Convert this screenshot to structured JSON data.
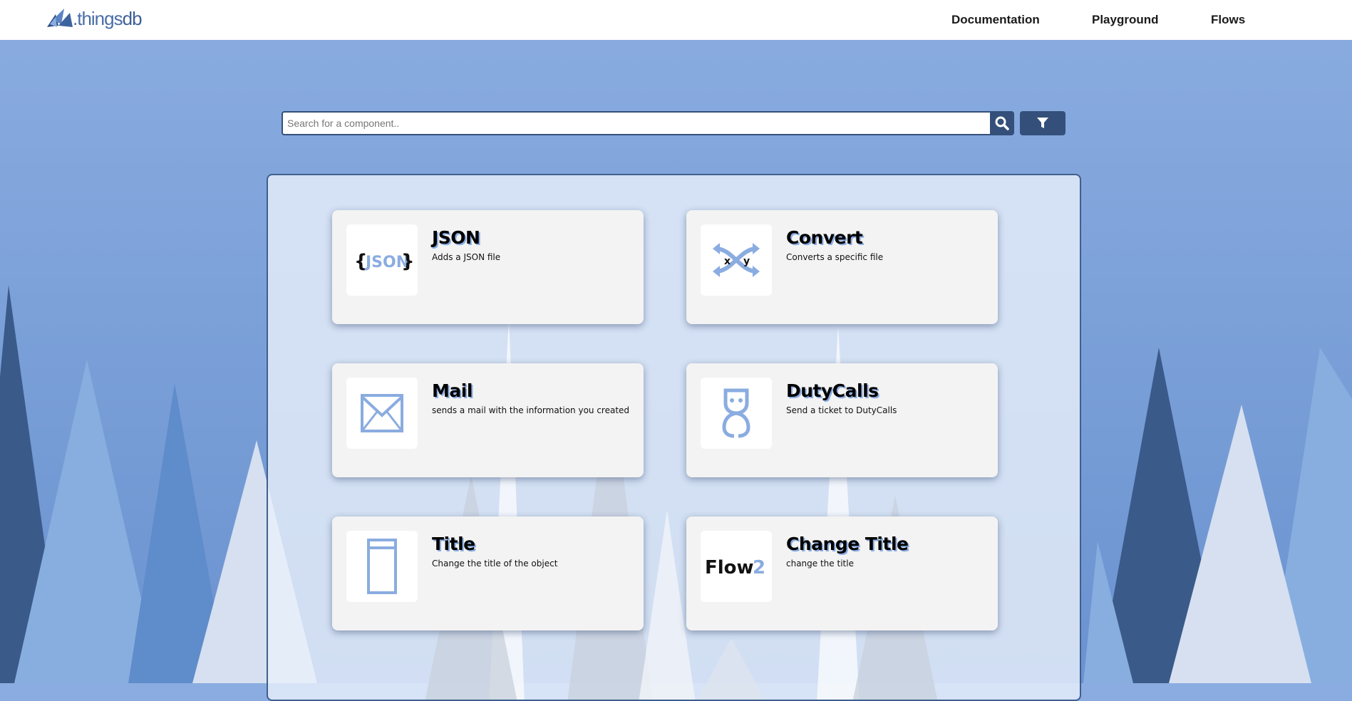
{
  "brand": {
    "name_prefix": ".things",
    "name_suffix": "db"
  },
  "nav": {
    "links": [
      {
        "label": "Documentation"
      },
      {
        "label": "Playground"
      },
      {
        "label": "Flows"
      }
    ]
  },
  "search": {
    "placeholder": "Search for a component..",
    "value": ""
  },
  "components": [
    {
      "title": "JSON",
      "description": "Adds a JSON file",
      "icon": "json-icon"
    },
    {
      "title": "Convert",
      "description": "Converts a specific file",
      "icon": "convert-xy-icon"
    },
    {
      "title": "Mail",
      "description": "sends a mail with the information you created",
      "icon": "mail-icon"
    },
    {
      "title": "DutyCalls",
      "description": "Send a ticket to DutyCalls",
      "icon": "dutycalls-icon"
    },
    {
      "title": "Title",
      "description": "Change the title of the object",
      "icon": "title-icon"
    },
    {
      "title": "Change Title",
      "description": "change the title",
      "icon": "flow2-icon"
    }
  ],
  "icon_text": {
    "json_left": "{",
    "json_mid": "JSON",
    "json_right": "}",
    "convert_x": "x",
    "convert_y": "y",
    "flow_word": "Flow",
    "flow_num": "2"
  },
  "colors": {
    "accent": "#8aace0",
    "dark": "#34507a",
    "card": "#f3f3f3"
  }
}
